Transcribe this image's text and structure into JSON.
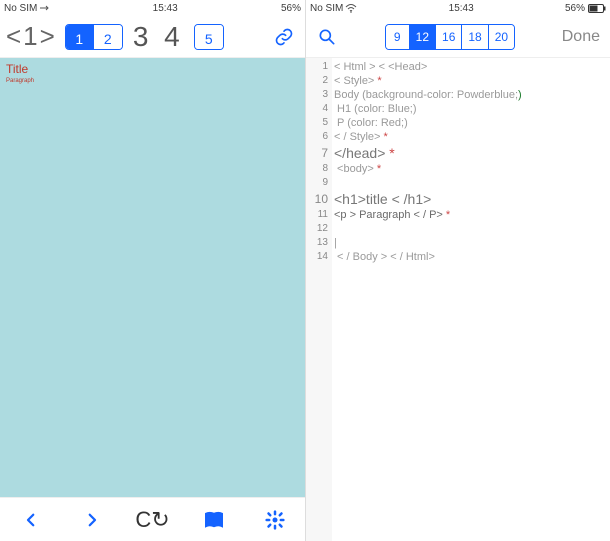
{
  "status": {
    "carrier": "No SIM",
    "time": "15:43",
    "battery_pct": "56%"
  },
  "left": {
    "toolbar": {
      "tag_label": "<1>",
      "seg": {
        "items": [
          "1",
          "2"
        ],
        "active": 0
      },
      "pair_label": "3 4",
      "seg2": {
        "items": [
          "5"
        ],
        "active": -1
      }
    },
    "preview": {
      "title": "Title",
      "paragraph": "Paragraph"
    },
    "bottom": {
      "back": "‹",
      "fwd": "›",
      "refresh": "↻",
      "book": "⌘",
      "settings": "⚙"
    }
  },
  "right": {
    "toolbar": {
      "seg": {
        "items": [
          "9",
          "12",
          "16",
          "18",
          "20"
        ],
        "active": 1
      },
      "done": "Done"
    },
    "code": {
      "lines": [
        {
          "n": "1",
          "big": false,
          "txt": "< Html > < <Head>"
        },
        {
          "n": "2",
          "big": false,
          "txt": "< Style>",
          "mark": "*"
        },
        {
          "n": "3",
          "big": false,
          "txt": "Body (background-color: Powderblue;",
          "cursor": ")"
        },
        {
          "n": "4",
          "big": false,
          "txt": " H1 (color: Blue;)"
        },
        {
          "n": "5",
          "big": false,
          "txt": " P (color: Red;)"
        },
        {
          "n": "6",
          "big": false,
          "txt": "< / Style>",
          "mark": "*"
        },
        {
          "n": "7",
          "big": true,
          "txt": "</head>",
          "mark": "*"
        },
        {
          "n": "8",
          "big": false,
          "txt": " <body>",
          "mark": "*"
        },
        {
          "n": "9",
          "big": false,
          "txt": ""
        },
        {
          "n": "10",
          "big": true,
          "txt": "<h1>title < /h1>"
        },
        {
          "n": "11",
          "big": false,
          "txt": "<p > Paragraph < / P>",
          "mark": "*"
        },
        {
          "n": "12",
          "big": false,
          "txt": ""
        },
        {
          "n": "13",
          "big": false,
          "txt": "|"
        },
        {
          "n": "14",
          "big": false,
          "txt": " < / Body > < / Html>"
        }
      ]
    }
  }
}
